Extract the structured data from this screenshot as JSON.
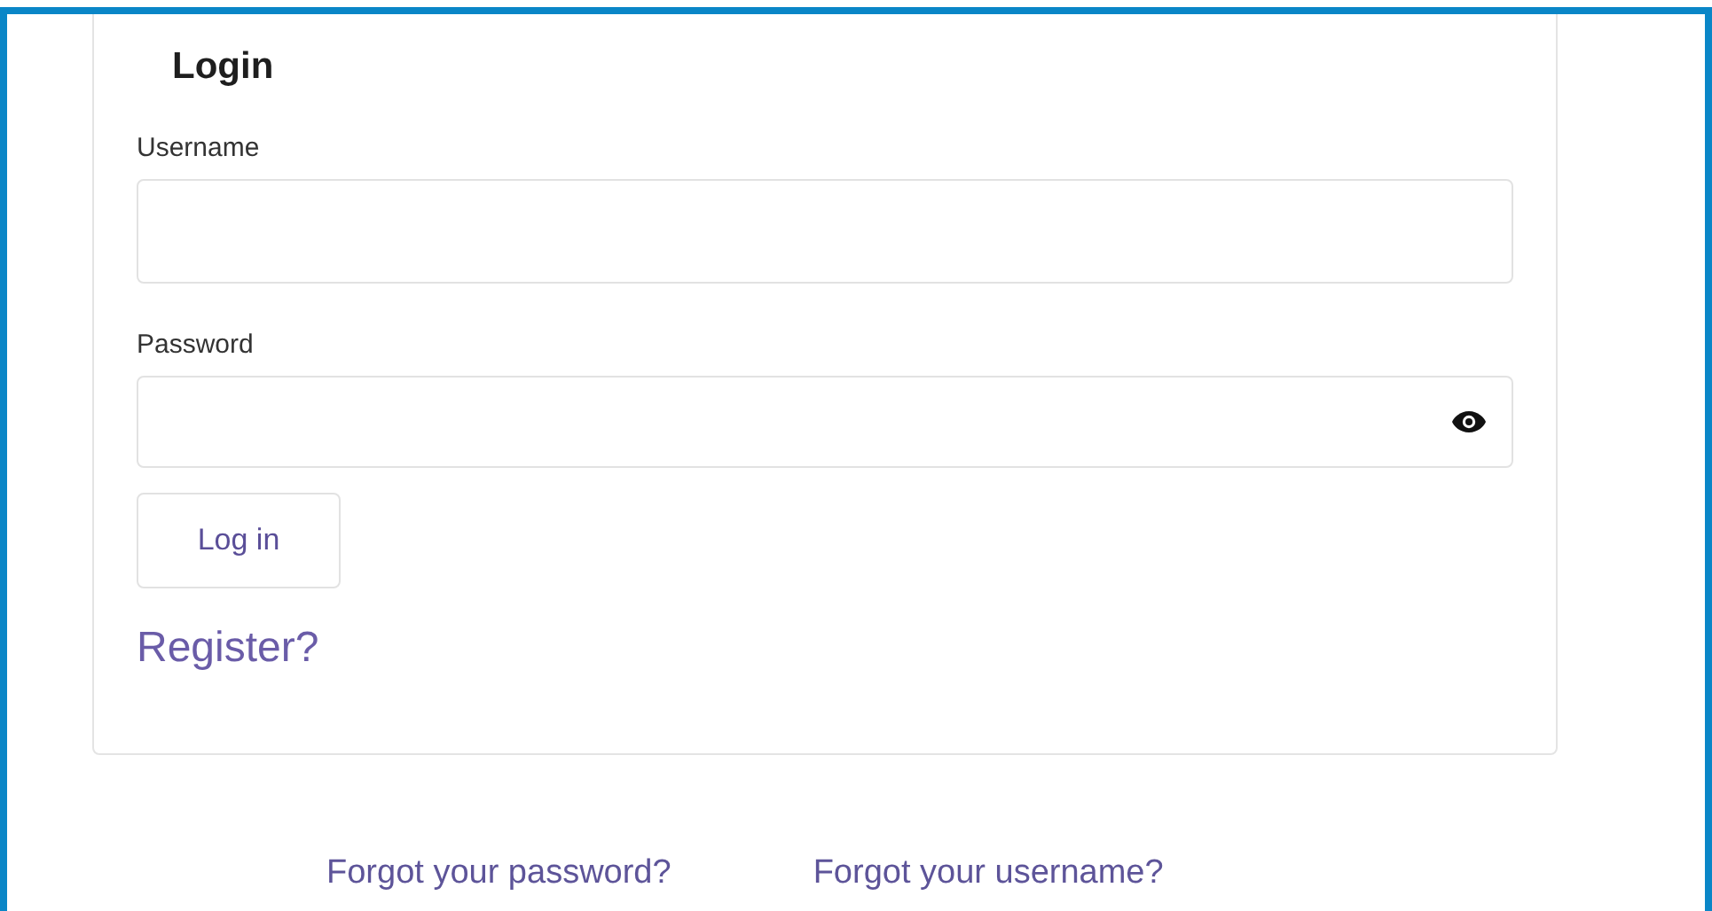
{
  "title": "Login",
  "fields": [
    {
      "label": "Username",
      "kind": "text"
    },
    {
      "label": "Password",
      "kind": "password"
    }
  ],
  "submit": "Log in",
  "register_link": "Register?",
  "footer_links": [
    "Forgot your password?",
    "Forgot your username?"
  ]
}
